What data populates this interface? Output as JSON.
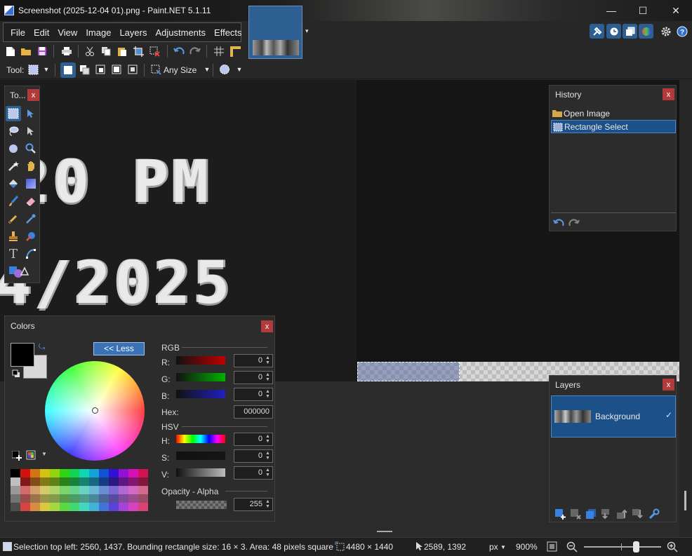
{
  "window": {
    "title": "Screenshot (2025-12-04 01).png - Paint.NET 5.1.11",
    "minimize_glyph": "—",
    "maximize_glyph": "☐",
    "close_glyph": "✕"
  },
  "menu": [
    "File",
    "Edit",
    "View",
    "Image",
    "Layers",
    "Adjustments",
    "Effects"
  ],
  "toolbar": {
    "tool_label": "Tool:",
    "size_label": "Any Size"
  },
  "canvas": {
    "line1": "20 PM",
    "line2": "4/2025"
  },
  "tools_panel": {
    "title": "To...",
    "close": "x"
  },
  "history_panel": {
    "title": "History",
    "close": "x",
    "items": [
      {
        "label": "Open Image",
        "icon": "folder-icon",
        "selected": false
      },
      {
        "label": "Rectangle Select",
        "icon": "rectangle-select-icon",
        "selected": true
      }
    ]
  },
  "layers_panel": {
    "title": "Layers",
    "close": "x",
    "layer_name": "Background",
    "visible_check": "✓"
  },
  "colors_panel": {
    "title": "Colors",
    "close": "x",
    "less_button": "<< Less",
    "rgb_label": "RGB",
    "hsv_label": "HSV",
    "opacity_label": "Opacity - Alpha",
    "hex_label": "Hex:",
    "hex_value": "000000",
    "r_label": "R:",
    "r_value": "0",
    "g_label": "G:",
    "g_value": "0",
    "b_label": "B:",
    "b_value": "0",
    "h_label": "H:",
    "h_value": "0",
    "s_label": "S:",
    "s_value": "0",
    "v_label": "V:",
    "v_value": "0",
    "alpha_value": "255",
    "primary_color": "#000000",
    "secondary_color": "#d8d8d8"
  },
  "status": {
    "selection_text": "Selection top left: 2560, 1437. Bounding rectangle size: 16 × 3. Area: 48 pixels square",
    "image_size": "4480 × 1440",
    "cursor_pos": "2589, 1392",
    "units": "px",
    "zoom": "900%"
  },
  "colors": {
    "accent": "#1c5088",
    "close_red": "#b33a3a",
    "selection_blue": "#2d5f93"
  }
}
